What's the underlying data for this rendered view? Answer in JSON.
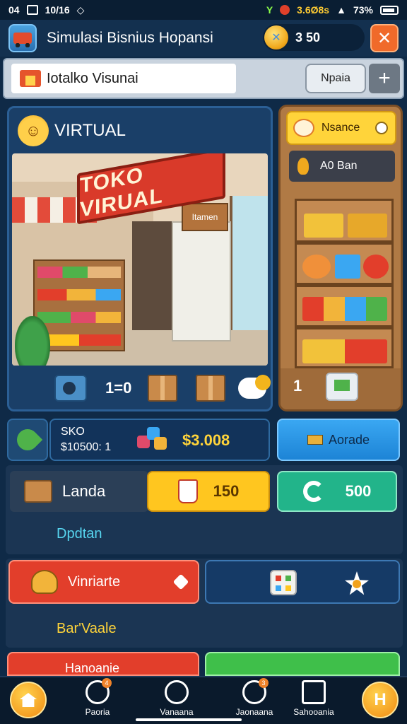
{
  "statusbar": {
    "left_text": "04",
    "date": "10/16",
    "speed": "3.6Ø8s",
    "battery": "73%"
  },
  "header": {
    "title": "Simulasi Bisnius Hopansi",
    "coins": "3 50",
    "close_label": "✕"
  },
  "search": {
    "value": "Iotalko Visunai",
    "button_label": "Npaia",
    "add_label": "+"
  },
  "store_panel": {
    "title": "VIRTUAL",
    "sign_text": "TOKO VIRUAL",
    "sub_sign": "Itamen",
    "counter": "1=0"
  },
  "side_panel": {
    "tag_label": "Nsance",
    "sub_label": "A0 Ban",
    "count": "1"
  },
  "stats": {
    "label": "SKO",
    "sub_value": "$10500: 1",
    "value": "$3.008",
    "upgrade_label": "Aorade"
  },
  "section2": {
    "bank_label": "Landa",
    "yellow_value": "150",
    "green_value": "500",
    "link_text": "Dpdtan"
  },
  "section3": {
    "red_label": "Vinriarte",
    "gold_text": "Bar'Vaale"
  },
  "section4": {
    "red_label": "Hanoanie"
  },
  "nav": {
    "items": [
      {
        "label": "Paoria",
        "badge": "4"
      },
      {
        "label": "Vanaana",
        "badge": ""
      },
      {
        "label": "Jaonaana",
        "badge": "3"
      },
      {
        "label": "Sahooania",
        "badge": ""
      }
    ],
    "menu_label": "H"
  },
  "colors": {
    "background": "#0f2a47",
    "accent_orange": "#f06a2a",
    "gold": "#ffd43a",
    "upgrade_blue": "#1d84d6",
    "green": "#22b48a",
    "red": "#e23e2b"
  },
  "icons": [
    "truck-icon",
    "coin-icon",
    "shop-icon",
    "crown-icon",
    "machine-icon",
    "box-icon",
    "hand-coin-icon",
    "pizza-icon",
    "check-icon",
    "flame-icon",
    "cash-icon",
    "leaf-icon",
    "gem-icon",
    "bar-icon",
    "wallet-icon",
    "cup-icon",
    "refresh-icon",
    "taco-icon",
    "heart-icon",
    "dice-icon",
    "star-icon",
    "house-icon"
  ]
}
